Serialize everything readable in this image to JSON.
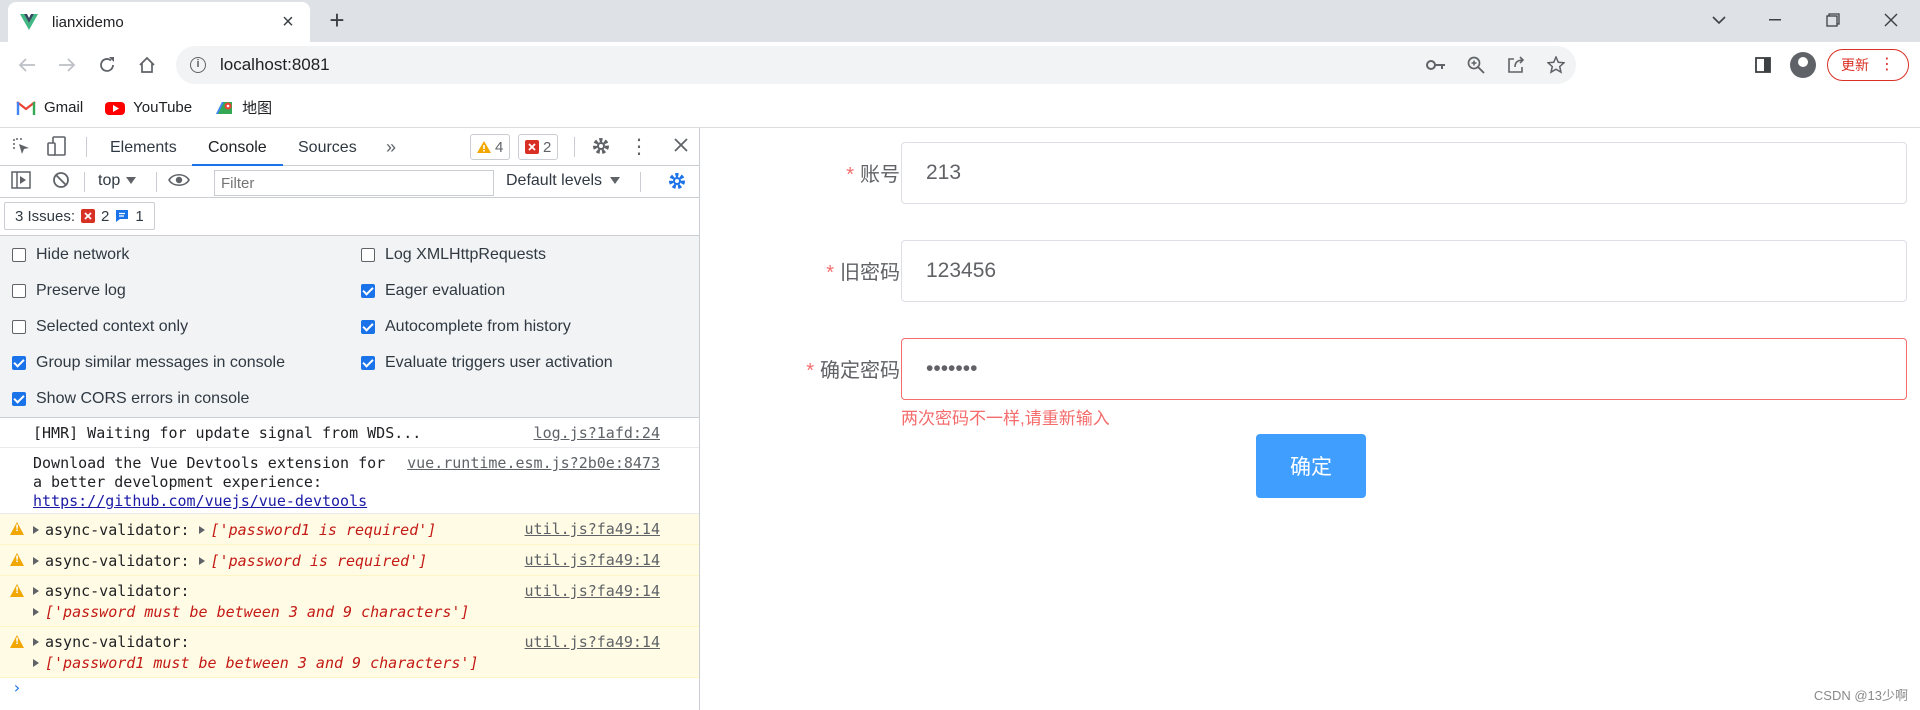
{
  "browser": {
    "tab_title": "lianxidemo",
    "url": "localhost:8081",
    "update_label": "更新",
    "bookmarks": [
      {
        "label": "Gmail",
        "icon": "gmail-icon"
      },
      {
        "label": "YouTube",
        "icon": "youtube-icon"
      },
      {
        "label": "地图",
        "icon": "maps-icon"
      }
    ]
  },
  "devtools": {
    "tabs": [
      "Elements",
      "Console",
      "Sources"
    ],
    "active_tab": "Console",
    "warning_count": "4",
    "error_count": "2",
    "context": "top",
    "filter_placeholder": "Filter",
    "levels_label": "Default levels",
    "issues_label": "3 Issues:",
    "issues_errors": "2",
    "issues_info": "1",
    "settings_left": [
      {
        "label": "Hide network",
        "checked": false
      },
      {
        "label": "Preserve log",
        "checked": false
      },
      {
        "label": "Selected context only",
        "checked": false
      },
      {
        "label": "Group similar messages in console",
        "checked": true
      },
      {
        "label": "Show CORS errors in console",
        "checked": true
      }
    ],
    "settings_right": [
      {
        "label": "Log XMLHttpRequests",
        "checked": false
      },
      {
        "label": "Eager evaluation",
        "checked": true
      },
      {
        "label": "Autocomplete from history",
        "checked": true
      },
      {
        "label": "Evaluate triggers user activation",
        "checked": true
      }
    ],
    "messages": {
      "m1_text": "[HMR] Waiting for update signal from WDS...",
      "m1_src": "log.js?1afd:24",
      "m2_line1": "Download the Vue Devtools extension for",
      "m2_line2": "a better development experience:",
      "m2_link": "https://github.com/vuejs/vue-devtools",
      "m2_src": "vue.runtime.esm.js?2b0e:8473",
      "w_prefix": "async-validator:",
      "w1_str": "['password1 is required']",
      "w2_str": "['password is required']",
      "w3_str": "['password must be between 3 and 9 characters']",
      "w4_str": "['password1 must be between 3 and 9 characters']",
      "w_src": "util.js?fa49:14"
    }
  },
  "form": {
    "account_label": "账号",
    "account_value": "213",
    "old_pwd_label": "旧密码",
    "old_pwd_value": "123456",
    "confirm_label": "确定密码",
    "confirm_value": "•••••••",
    "error_text": "两次密码不一样,请重新输入",
    "submit_label": "确定",
    "required_mark": "*"
  },
  "watermark": "CSDN @13少啊",
  "colors": {
    "primary_button": "#409eff",
    "error": "#f56c6c",
    "devtools_accent": "#1a73e8"
  }
}
